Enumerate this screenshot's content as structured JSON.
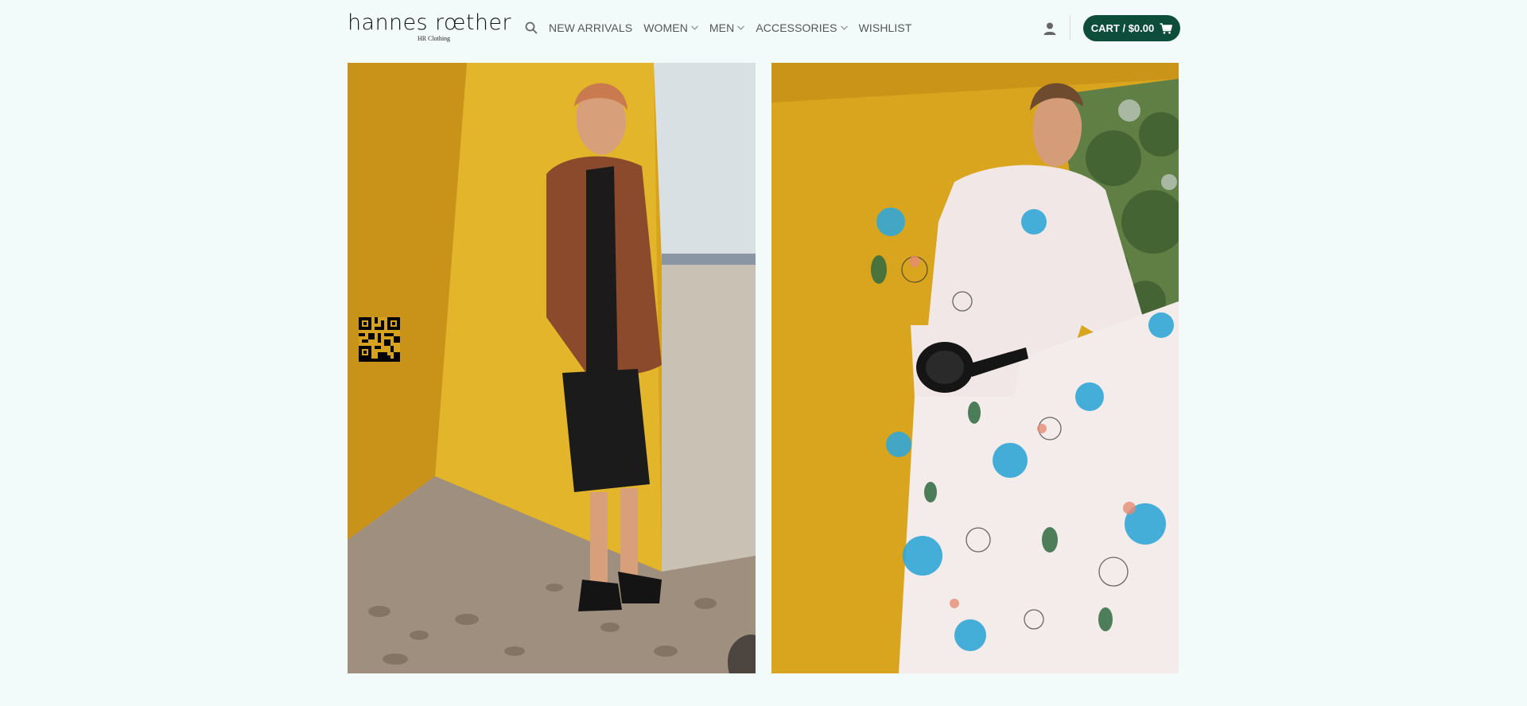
{
  "brand": {
    "name": "hannes rœther",
    "tagline": "HR Clothing"
  },
  "nav": {
    "search_icon": "search-icon",
    "items": [
      {
        "label": "NEW ARRIVALS",
        "has_dropdown": false
      },
      {
        "label": "WOMEN",
        "has_dropdown": true
      },
      {
        "label": "MEN",
        "has_dropdown": true
      },
      {
        "label": "ACCESSORIES",
        "has_dropdown": true
      },
      {
        "label": "WISHLIST",
        "has_dropdown": false
      }
    ]
  },
  "account": {
    "icon": "user-icon"
  },
  "cart": {
    "label": "CART / $0.00",
    "icon": "cart-icon",
    "color": "#0f4d3b"
  },
  "hero": {
    "panels": [
      {
        "description": "woman-brown-leather-jacket-yellow-wall",
        "accent": "#d8a51f"
      },
      {
        "description": "woman-floral-dress-yellow-wall",
        "accent": "#d9a51f"
      }
    ],
    "controls": {
      "pause_icon": "pause-icon",
      "qr_icon": "qr-code-icon"
    }
  },
  "colors": {
    "background": "#f3fbfa",
    "nav_text": "#555555",
    "cart_bg": "#0f4d3b"
  }
}
